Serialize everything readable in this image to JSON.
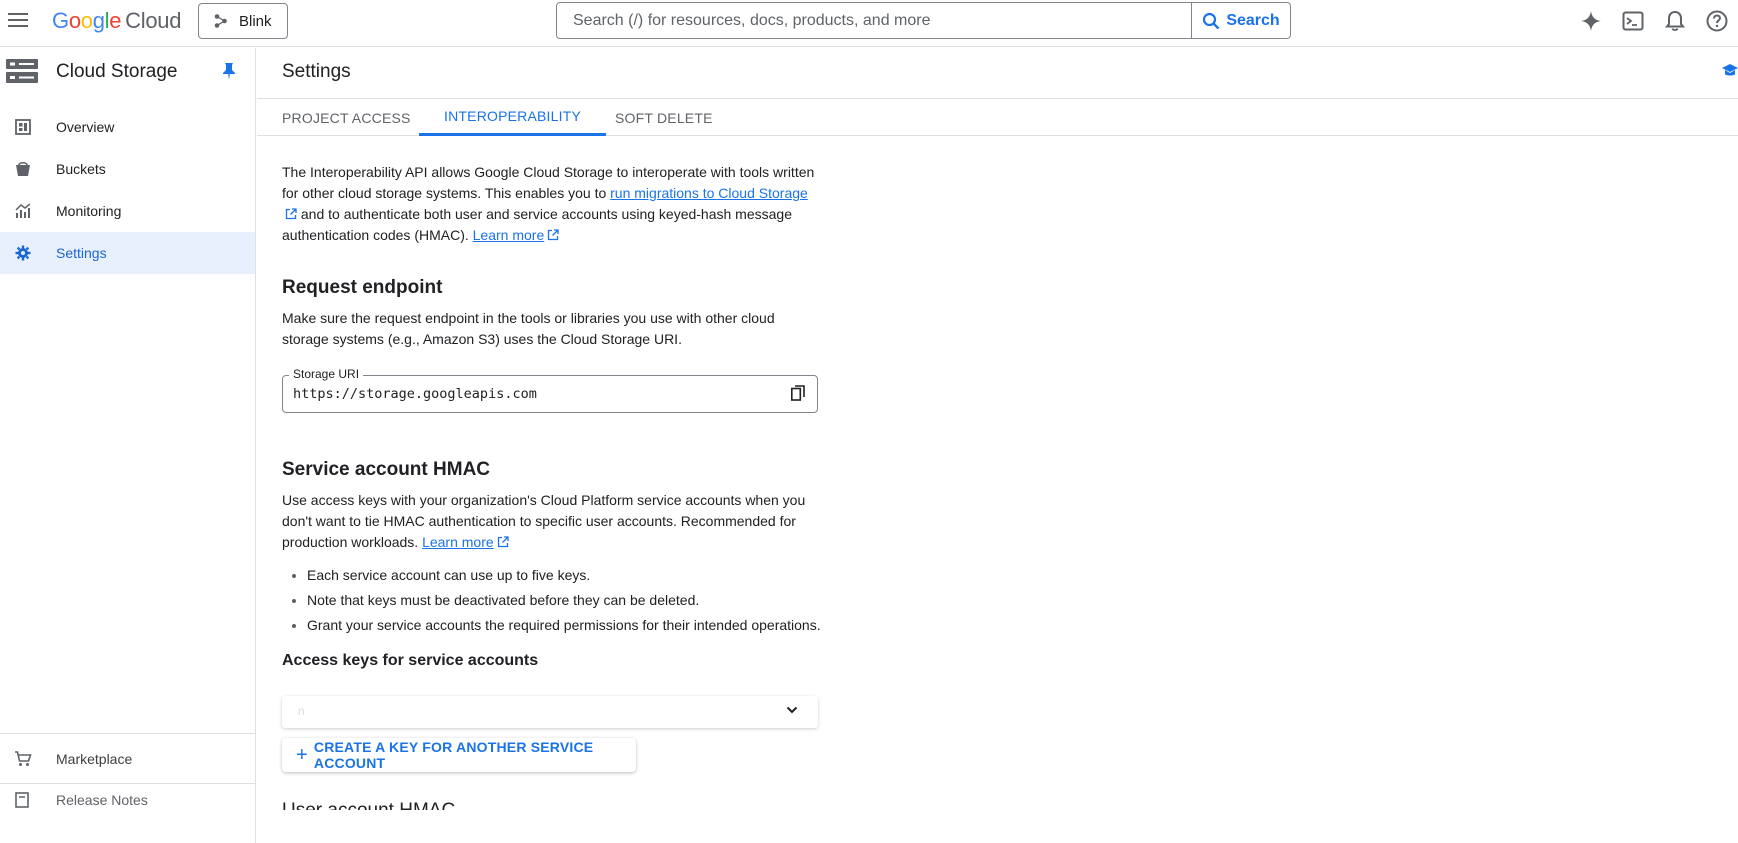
{
  "topbar": {
    "logo_google": [
      "G",
      "o",
      "o",
      "g",
      "l",
      "e"
    ],
    "logo_cloud": "Cloud",
    "project_name": "Blink",
    "search_placeholder": "Search (/) for resources, docs, products, and more",
    "search_button": "Search",
    "icons": [
      "gemini-sparkle-icon",
      "cloud-shell-icon",
      "notifications-icon",
      "help-icon"
    ]
  },
  "sidebar": {
    "product_title": "Cloud Storage",
    "items": [
      {
        "label": "Overview",
        "icon": "overview-icon"
      },
      {
        "label": "Buckets",
        "icon": "buckets-icon"
      },
      {
        "label": "Monitoring",
        "icon": "monitoring-icon"
      },
      {
        "label": "Settings",
        "icon": "settings-gear-icon",
        "active": true
      }
    ],
    "bottom_items": [
      {
        "label": "Marketplace",
        "icon": "marketplace-cart-icon"
      },
      {
        "label": "Release Notes",
        "icon": "release-notes-icon"
      }
    ]
  },
  "main": {
    "title": "Settings",
    "tabs": [
      {
        "label": "PROJECT ACCESS"
      },
      {
        "label": "INTEROPERABILITY",
        "active": true
      },
      {
        "label": "SOFT DELETE"
      }
    ],
    "intro": {
      "text1": "The Interoperability API allows Google Cloud Storage to interoperate with tools written for other cloud storage systems. This enables you to ",
      "link1": "run migrations to Cloud Storage",
      "text2": " and to authenticate both user and service accounts using keyed-hash message authentication codes (HMAC). ",
      "link2": "Learn more"
    },
    "request_endpoint": {
      "heading": "Request endpoint",
      "description": "Make sure the request endpoint in the tools or libraries you use with other cloud storage systems (e.g., Amazon S3) uses the Cloud Storage URI.",
      "field_label": "Storage URI",
      "field_value": "https://storage.googleapis.com"
    },
    "service_hmac": {
      "heading": "Service account HMAC",
      "description": "Use access keys with your organization's Cloud Platform service accounts when you don't want to tie HMAC authentication to specific user accounts. Recommended for production workloads. ",
      "link": "Learn more",
      "bullets": [
        "Each service account can use up to five keys.",
        "Note that keys must be deactivated before they can be deleted.",
        "Grant your service accounts the required permissions for their intended operations."
      ],
      "access_keys_heading": "Access keys for service accounts",
      "select_value": "n",
      "create_button": "CREATE A KEY FOR ANOTHER SERVICE ACCOUNT"
    },
    "user_hmac_heading": "User account HMAC"
  }
}
